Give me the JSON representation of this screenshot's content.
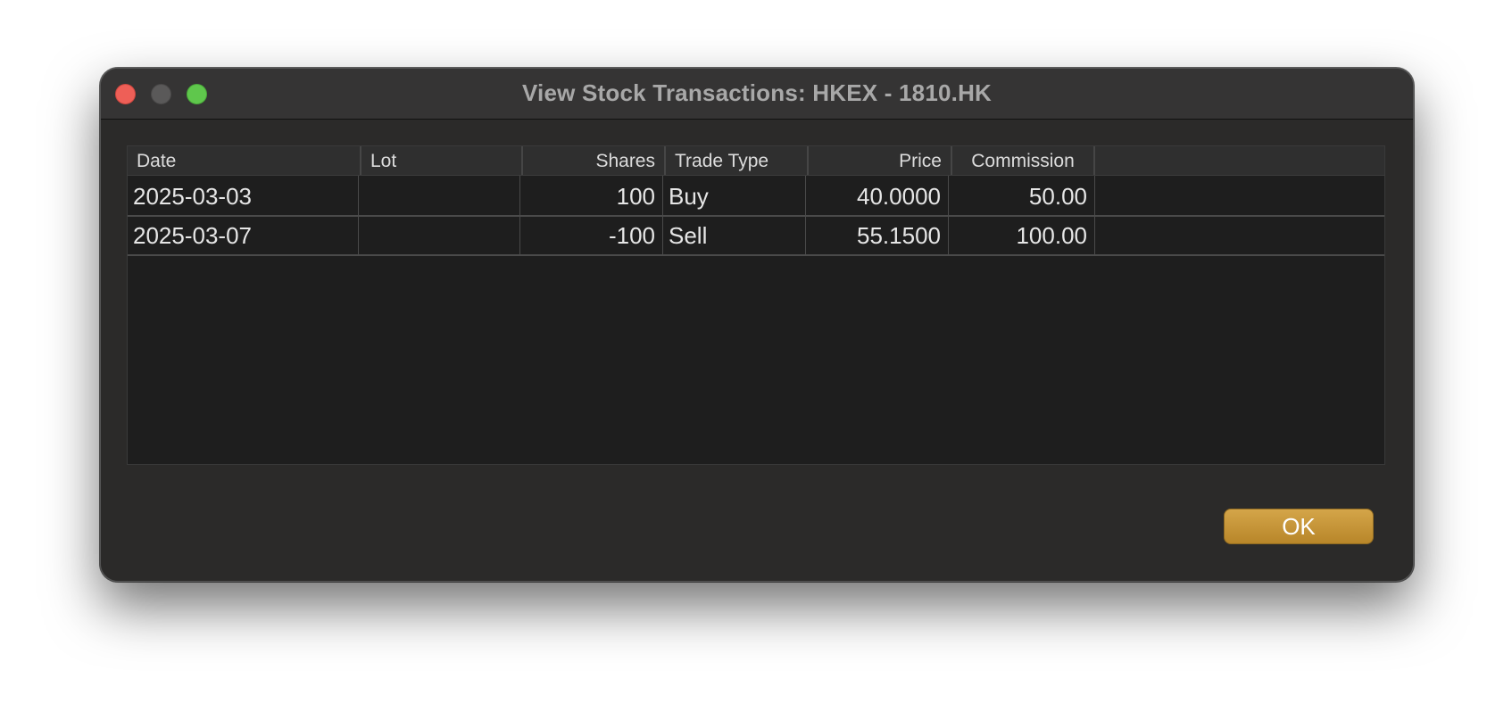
{
  "window": {
    "title": "View Stock Transactions: HKEX - 1810.HK"
  },
  "table": {
    "columns": [
      "Date",
      "Lot",
      "Shares",
      "Trade Type",
      "Price",
      "Commission"
    ],
    "rows": [
      [
        "2025-03-03",
        "",
        "100",
        "Buy",
        "40.0000",
        "50.00"
      ],
      [
        "2025-03-07",
        "",
        "-100",
        "Sell",
        "55.1500",
        "100.00"
      ]
    ]
  },
  "buttons": {
    "ok_label": "OK"
  },
  "colors": {
    "accent": "#c6963a",
    "close": "#ee5f57",
    "zoom": "#5fc74c"
  }
}
